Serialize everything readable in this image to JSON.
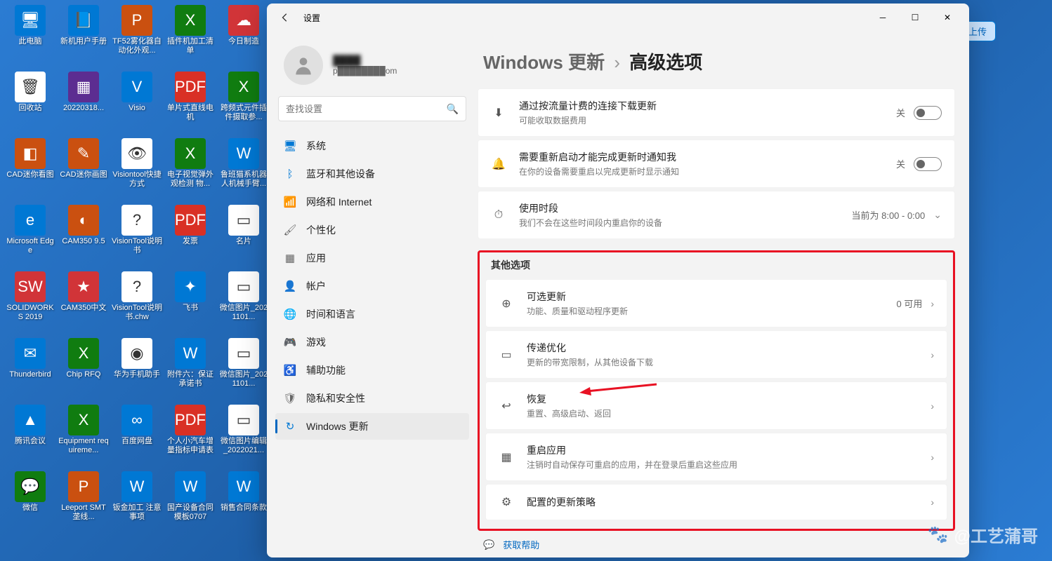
{
  "desktop": {
    "icons": [
      {
        "label": "此电脑",
        "color": "ic-blue",
        "glyph": "🖥"
      },
      {
        "label": "新机用户手册",
        "color": "ic-blue",
        "glyph": "📘"
      },
      {
        "label": "TF52雾化器自动化外观...",
        "color": "ic-orange",
        "glyph": "P"
      },
      {
        "label": "插件机加工清单",
        "color": "ic-green",
        "glyph": "X"
      },
      {
        "label": "今日制造",
        "color": "ic-red",
        "glyph": "☁"
      },
      {
        "label": "回收站",
        "color": "ic-white",
        "glyph": "🗑"
      },
      {
        "label": "20220318...",
        "color": "ic-purple",
        "glyph": "▦"
      },
      {
        "label": "Visio",
        "color": "ic-blue",
        "glyph": "V"
      },
      {
        "label": "单片式直线电机",
        "color": "ic-pdf",
        "glyph": "PDF"
      },
      {
        "label": "跨频式元件插件摄取参...",
        "color": "ic-green",
        "glyph": "X"
      },
      {
        "label": "CAD迷你看图",
        "color": "ic-orange",
        "glyph": "◧"
      },
      {
        "label": "CAD迷你画图",
        "color": "ic-orange",
        "glyph": "✎"
      },
      {
        "label": "Visiontool快捷方式",
        "color": "ic-white",
        "glyph": "👁"
      },
      {
        "label": "电子视觉弹外观检测 物...",
        "color": "ic-green",
        "glyph": "X"
      },
      {
        "label": "鲁班猫系机器人机械手臂...",
        "color": "ic-blue",
        "glyph": "W"
      },
      {
        "label": "Microsoft Edge",
        "color": "ic-blue",
        "glyph": "e"
      },
      {
        "label": "CAM350 9.5",
        "color": "ic-orange",
        "glyph": "◐"
      },
      {
        "label": "VisionTool说明书",
        "color": "ic-white",
        "glyph": "?"
      },
      {
        "label": "发票",
        "color": "ic-pdf",
        "glyph": "PDF"
      },
      {
        "label": "名片",
        "color": "ic-white",
        "glyph": "▭"
      },
      {
        "label": "SOLIDWORKS 2019",
        "color": "ic-red",
        "glyph": "SW"
      },
      {
        "label": "CAM350中文",
        "color": "ic-red",
        "glyph": "★"
      },
      {
        "label": "VisionTool说明书.chw",
        "color": "ic-white",
        "glyph": "?"
      },
      {
        "label": "飞书",
        "color": "ic-blue",
        "glyph": "✦"
      },
      {
        "label": "微信图片_2021101...",
        "color": "ic-white",
        "glyph": "▭"
      },
      {
        "label": "Thunderbird",
        "color": "ic-blue",
        "glyph": "✉"
      },
      {
        "label": "Chip RFQ",
        "color": "ic-green",
        "glyph": "X"
      },
      {
        "label": "华为手机助手",
        "color": "ic-white",
        "glyph": "◉"
      },
      {
        "label": "附件六：保证承诺书",
        "color": "ic-blue",
        "glyph": "W"
      },
      {
        "label": "微信图片_2021101...",
        "color": "ic-white",
        "glyph": "▭"
      },
      {
        "label": "腾讯会议",
        "color": "ic-blue",
        "glyph": "▲"
      },
      {
        "label": "Equipment requireme...",
        "color": "ic-green",
        "glyph": "X"
      },
      {
        "label": "百度网盘",
        "color": "ic-blue",
        "glyph": "∞"
      },
      {
        "label": "个人小汽车增量指标申请表",
        "color": "ic-pdf",
        "glyph": "PDF"
      },
      {
        "label": "微信图片编辑_2022021...",
        "color": "ic-white",
        "glyph": "▭"
      },
      {
        "label": "微信",
        "color": "ic-green",
        "glyph": "💬"
      },
      {
        "label": "Leeport SMT 垄线...",
        "color": "ic-orange",
        "glyph": "P"
      },
      {
        "label": "钣金加工 注意事项",
        "color": "ic-blue",
        "glyph": "W"
      },
      {
        "label": "国产设备合同模板0707",
        "color": "ic-blue",
        "glyph": "W"
      },
      {
        "label": "销售合同条款",
        "color": "ic-blue",
        "glyph": "W"
      }
    ]
  },
  "window": {
    "title": "设置",
    "user": {
      "name": "████",
      "email": "p████████om"
    },
    "search_placeholder": "查找设置",
    "nav": [
      {
        "label": "系统",
        "icon": "🖥",
        "color": "#0078d4"
      },
      {
        "label": "蓝牙和其他设备",
        "icon": "ᛒ",
        "color": "#0078d4"
      },
      {
        "label": "网络和 Internet",
        "icon": "📶",
        "color": "#0078d4"
      },
      {
        "label": "个性化",
        "icon": "🖌",
        "color": "#666"
      },
      {
        "label": "应用",
        "icon": "▦",
        "color": "#666"
      },
      {
        "label": "帐户",
        "icon": "👤",
        "color": "#0078d4"
      },
      {
        "label": "时间和语言",
        "icon": "🌐",
        "color": "#666"
      },
      {
        "label": "游戏",
        "icon": "🎮",
        "color": "#666"
      },
      {
        "label": "辅助功能",
        "icon": "♿",
        "color": "#0078d4"
      },
      {
        "label": "隐私和安全性",
        "icon": "🛡",
        "color": "#666"
      },
      {
        "label": "Windows 更新",
        "icon": "↻",
        "color": "#0078d4",
        "active": true
      }
    ],
    "breadcrumb": {
      "parent": "Windows 更新",
      "current": "高级选项"
    },
    "top_cards": [
      {
        "icon": "⬇",
        "title": "通过按流量计费的连接下载更新",
        "desc": "可能收取数据费用",
        "trail_label": "关",
        "toggle": true
      },
      {
        "icon": "🔔",
        "title": "需要重新启动才能完成更新时通知我",
        "desc": "在你的设备需要重启以完成更新时显示通知",
        "trail_label": "关",
        "toggle": true
      },
      {
        "icon": "⏱",
        "title": "使用时段",
        "desc": "我们不会在这些时间段内重启你的设备",
        "trail_label": "当前为 8:00 - 0:00",
        "chev": "⌄"
      }
    ],
    "section_title": "其他选项",
    "other_cards": [
      {
        "icon": "⊕",
        "title": "可选更新",
        "desc": "功能、质量和驱动程序更新",
        "trail_label": "0 可用",
        "chev": "›"
      },
      {
        "icon": "▭",
        "title": "传递优化",
        "desc": "更新的带宽限制，从其他设备下载",
        "chev": "›"
      },
      {
        "icon": "↩",
        "title": "恢复",
        "desc": "重置、高级启动、返回",
        "chev": "›"
      },
      {
        "icon": "▦",
        "title": "重启应用",
        "desc": "注销时自动保存可重启的应用，并在登录后重启这些应用",
        "chev": "›"
      },
      {
        "icon": "⚙",
        "title": "配置的更新策略",
        "desc": "",
        "chev": "›"
      }
    ],
    "help_link": "获取帮助"
  },
  "upload_btn": "上传",
  "watermark": "@工艺蒲哥"
}
